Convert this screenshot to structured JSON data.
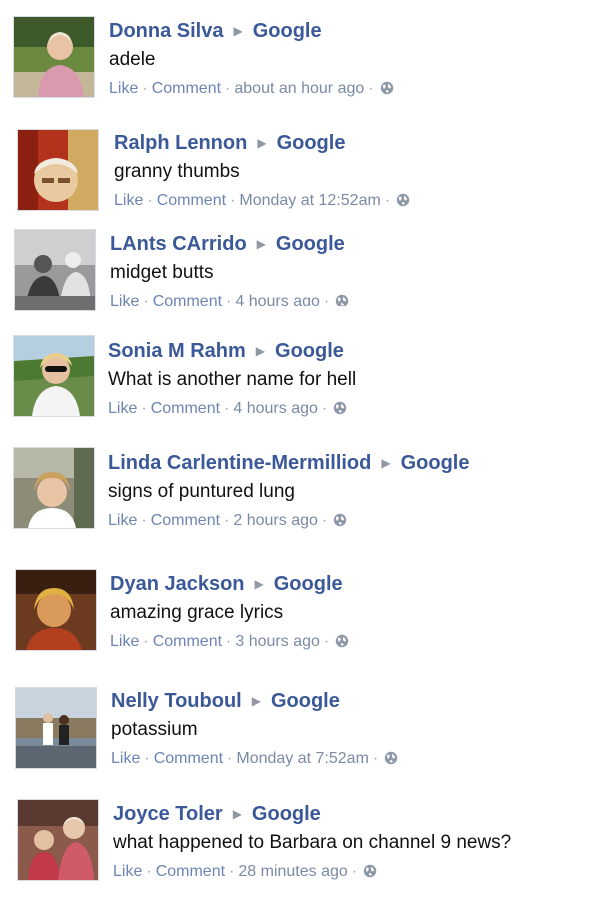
{
  "posts": [
    {
      "name": "Donna Silva",
      "target": "Google",
      "text": "adele",
      "like": "Like",
      "comment": "Comment",
      "time": "about an hour ago",
      "avatar_bg": "#6b8a3f"
    },
    {
      "name": "Ralph Lennon",
      "target": "Google",
      "text": "granny thumbs",
      "like": "Like",
      "comment": "Comment",
      "time": "Monday at 12:52am",
      "avatar_bg": "#b2321c"
    },
    {
      "name": "LAnts CArrido",
      "target": "Google",
      "text": "midget butts",
      "like": "Like",
      "comment": "Comment",
      "time": "4 hours ago",
      "avatar_bg": "#9a9a9a"
    },
    {
      "name": "Sonia M Rahm",
      "target": "Google",
      "text": "What is another name for hell",
      "like": "Like",
      "comment": "Comment",
      "time": "4 hours ago",
      "avatar_bg": "#6a8c4a"
    },
    {
      "name": "Linda Carlentine-Mermilliod",
      "target": "Google",
      "text": "signs of puntured lung",
      "like": "Like",
      "comment": "Comment",
      "time": "2 hours ago",
      "avatar_bg": "#8c8c78"
    },
    {
      "name": "Dyan Jackson",
      "target": "Google",
      "text": "amazing grace lyrics",
      "like": "Like",
      "comment": "Comment",
      "time": "3 hours ago",
      "avatar_bg": "#6b3a1f"
    },
    {
      "name": "Nelly Touboul",
      "target": "Google",
      "text": "potassium",
      "like": "Like",
      "comment": "Comment",
      "time": "Monday at 7:52am",
      "avatar_bg": "#7a8a99"
    },
    {
      "name": "Joyce Toler",
      "target": "Google",
      "text": "what happened to Barbara on channel 9 news?",
      "like": "Like",
      "comment": "Comment",
      "time": "28 minutes ago",
      "avatar_bg": "#8a5a4a"
    }
  ]
}
